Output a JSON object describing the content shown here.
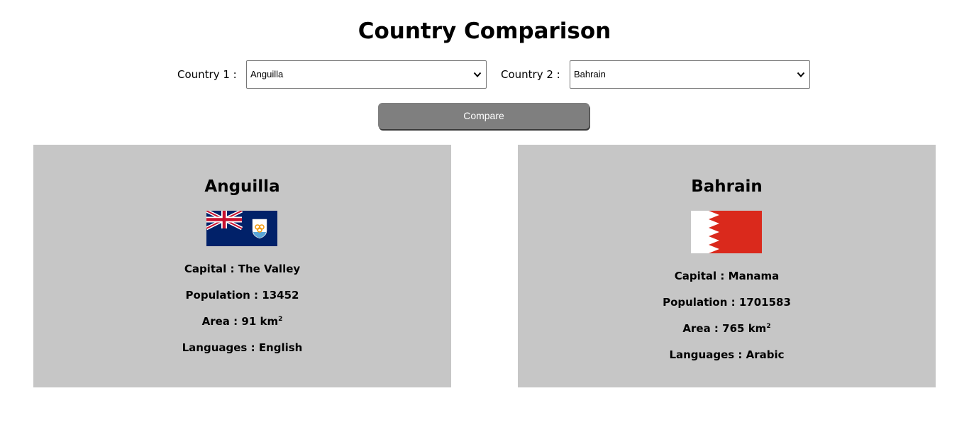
{
  "page": {
    "title": "Country Comparison"
  },
  "selectors": {
    "country1": {
      "label": "Country 1 :",
      "value": "Anguilla"
    },
    "country2": {
      "label": "Country 2 :",
      "value": "Bahrain"
    }
  },
  "compare_button": {
    "label": "Compare"
  },
  "cards": [
    {
      "name": "Anguilla",
      "flag_icon": "anguilla-flag",
      "capital_label": "Capital :",
      "capital": "The Valley",
      "population_label": "Population :",
      "population": "13452",
      "area_label": "Area :",
      "area": "91 km",
      "area_unit_sup": "2",
      "languages_label": "Languages :",
      "languages": "English"
    },
    {
      "name": "Bahrain",
      "flag_icon": "bahrain-flag",
      "capital_label": "Capital :",
      "capital": "Manama",
      "population_label": "Population :",
      "population": "1701583",
      "area_label": "Area :",
      "area": "765 km",
      "area_unit_sup": "2",
      "languages_label": "Languages :",
      "languages": "Arabic"
    }
  ],
  "colors": {
    "card_background": "#c6c6c6",
    "button_background": "#7f7f7f",
    "anguilla_blue": "#012169",
    "bahrain_red": "#da291c"
  }
}
